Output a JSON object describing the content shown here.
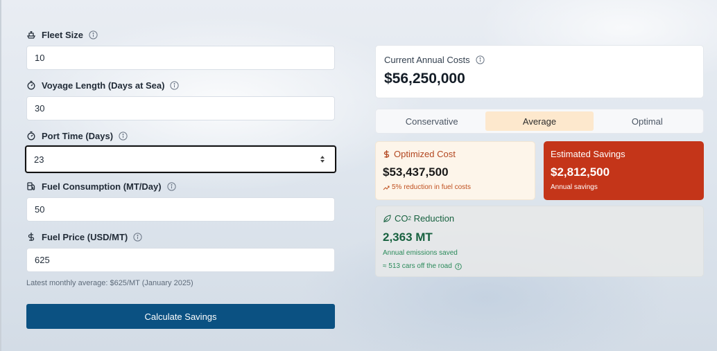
{
  "form": {
    "fleet_size": {
      "label": "Fleet Size",
      "value": "10",
      "icon": "ship-icon"
    },
    "voyage_length": {
      "label": "Voyage Length (Days at Sea)",
      "value": "30",
      "icon": "timer-icon"
    },
    "port_time": {
      "label": "Port Time (Days)",
      "value": "23",
      "icon": "timer-icon"
    },
    "fuel_consumption": {
      "label": "Fuel Consumption (MT/Day)",
      "value": "50",
      "icon": "fuel-pump-icon"
    },
    "fuel_price": {
      "label": "Fuel Price (USD/MT)",
      "value": "625",
      "icon": "dollar-icon"
    },
    "fuel_price_hint": "Latest monthly average: $625/MT (January 2025)",
    "calculate_label": "Calculate Savings"
  },
  "results": {
    "current": {
      "label": "Current Annual Costs",
      "value": "$56,250,000"
    },
    "tabs": [
      {
        "label": "Conservative",
        "active": false
      },
      {
        "label": "Average",
        "active": true
      },
      {
        "label": "Optimal",
        "active": false
      }
    ],
    "optimized": {
      "label": "Optimized Cost",
      "value": "$53,437,500",
      "sub": "5% reduction in fuel costs"
    },
    "savings": {
      "label": "Estimated Savings",
      "value": "$2,812,500",
      "sub": "Annual savings"
    },
    "co2": {
      "label_prefix": "CO",
      "label_subscript": "2",
      "label_suffix": " Reduction",
      "value": "2,363 MT",
      "sub": "Annual emissions saved",
      "cars": "≈ 513 cars off the road"
    }
  },
  "colors": {
    "accent_button": "#0b5182",
    "active_tab": "#fde8cd",
    "savings_bg": "#c43519",
    "co2_text": "#17613f"
  }
}
